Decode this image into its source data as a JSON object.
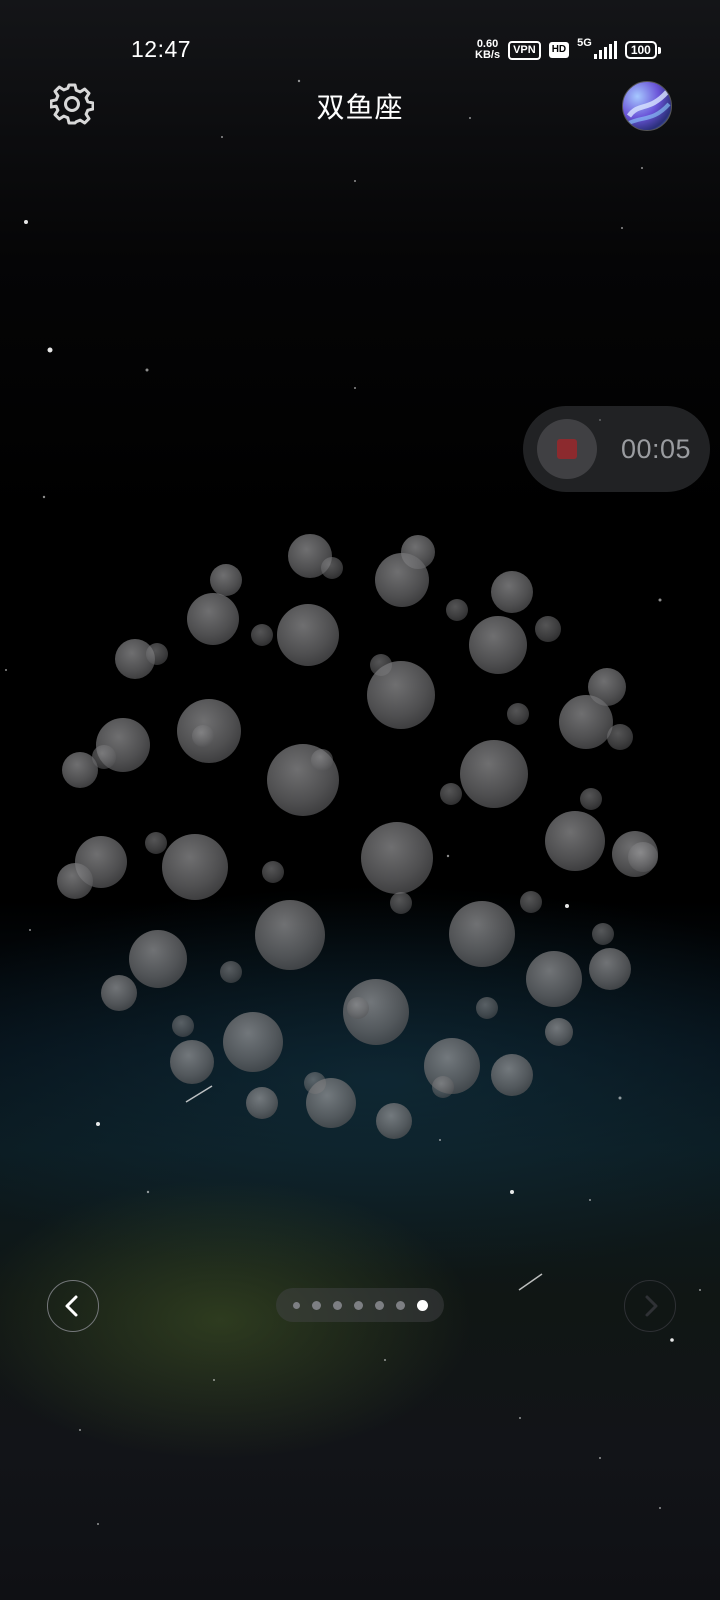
{
  "status_bar": {
    "time": "12:47",
    "net_speed_value": "0.60",
    "net_speed_unit": "KB/s",
    "vpn_label": "VPN",
    "hd_label": "HD",
    "network_label": "5G",
    "battery_level": "100"
  },
  "header": {
    "title": "双鱼座",
    "settings_icon": "gear-icon",
    "avatar_icon": "avatar-image"
  },
  "recorder": {
    "elapsed": "00:05",
    "stop_icon": "stop-icon",
    "stop_color": "#8c2a2e"
  },
  "pager": {
    "page_count": 7,
    "current_page": 7,
    "prev_icon": "chevron-left-icon",
    "next_icon": "chevron-right-icon"
  },
  "colors": {
    "background": "#000000",
    "bubble": "#8a8a8a",
    "text_primary": "#ffffff",
    "text_muted": "#9a9ca0"
  }
}
